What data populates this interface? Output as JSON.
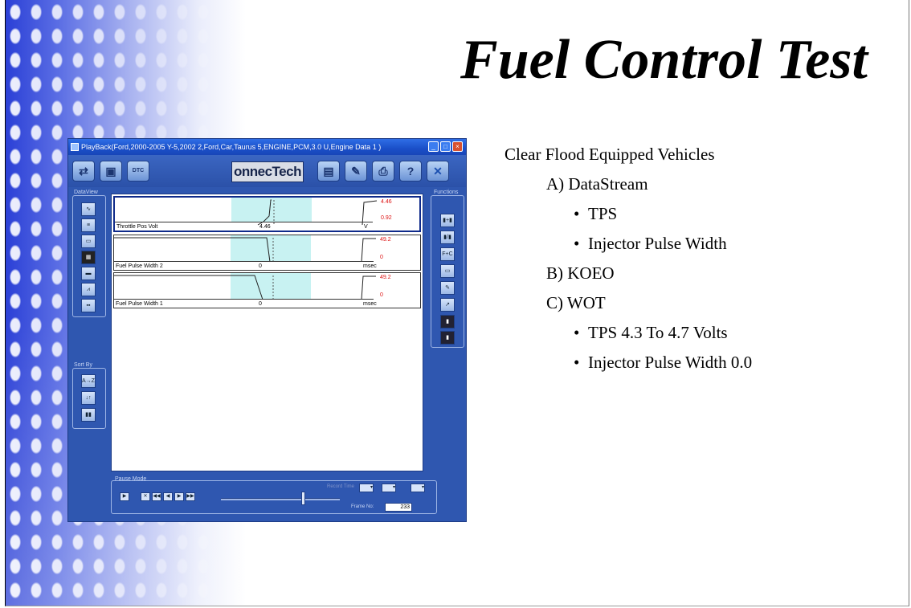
{
  "slide": {
    "title": "Fuel Control Test",
    "bullets": [
      {
        "text": "Clear Flood  Equipped Vehicles",
        "level": 0
      },
      {
        "text": "A) DataStream",
        "level": 1
      },
      {
        "text": "TPS",
        "level": 2
      },
      {
        "text": "Injector Pulse Width",
        "level": 2
      },
      {
        "text": "B) KOEO",
        "level": 1
      },
      {
        "text": "C) WOT",
        "level": 1
      },
      {
        "text": "TPS 4.3 To 4.7 Volts",
        "level": 2
      },
      {
        "text": "Injector Pulse Width 0.0",
        "level": 2
      }
    ]
  },
  "app": {
    "window_title": "PlayBack(Ford,2000-2005 Y-5,2002 2,Ford,Car,Taurus 5,ENGINE,PCM,3.0 U,Engine Data 1 )",
    "logo_text": "onnecTech",
    "toolbar_left_icons": [
      "vehicle-icon",
      "module-icon",
      "dtc-icon"
    ],
    "toolbar_right_icons": [
      "record-icon",
      "tools-icon",
      "print-icon",
      "help-icon",
      "exit-icon"
    ],
    "dataview_label": "DataView",
    "sortby_label": "Sort By",
    "functions_label": "Functions",
    "sortby_buttons": [
      "A→Z",
      "↓↑",
      "▮▮"
    ],
    "function_buttons": [
      "▮+▮",
      "▮/▮",
      "F+C"
    ],
    "traces": [
      {
        "name": "Throttle Pos Volt",
        "value": "4.46",
        "unit": "V",
        "max": "4.46",
        "min": "0.92",
        "selected": true
      },
      {
        "name": "Fuel Pulse Width 2",
        "value": "0",
        "unit": "msec",
        "max": "49.2",
        "min": "0",
        "selected": false
      },
      {
        "name": "Fuel Pulse Width 1",
        "value": "0",
        "unit": "msec",
        "max": "49.2",
        "min": "0",
        "selected": false
      }
    ],
    "pause_mode_label": "Pause Mode",
    "record_time_label": "Record Time",
    "frame_label": "Frame No:",
    "frame_value": "233"
  }
}
